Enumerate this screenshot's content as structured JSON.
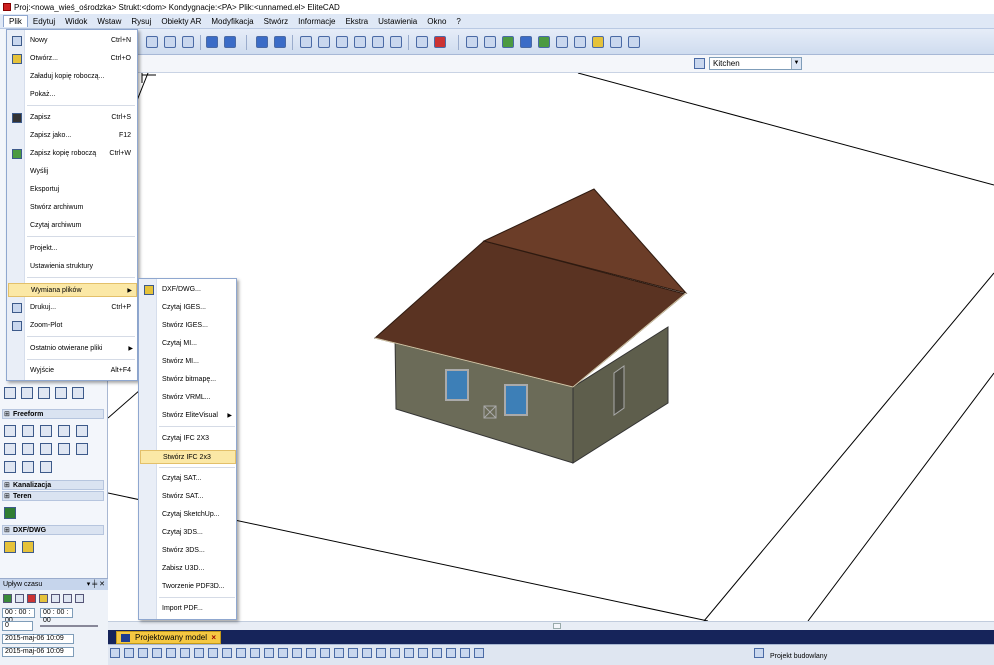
{
  "window": {
    "title": "Proj:<nowa_wieś_ośrodzka> Strukt:<dom>  Kondygnacje:<PA>  Plik:<unnamed.el> EliteCAD"
  },
  "menubar": [
    "Plik",
    "Edytuj",
    "Widok",
    "Wstaw",
    "Rysuj",
    "Obiekty AR",
    "Modyfikacja",
    "Stwórz",
    "Informacje",
    "Ekstra",
    "Ustawienia",
    "Okno",
    "?"
  ],
  "layer_combo": {
    "value": "Kitchen"
  },
  "file_menu": [
    {
      "label": "Nowy",
      "shortcut": "Ctrl+N",
      "icon": "new-file-icon"
    },
    {
      "label": "Otwórz...",
      "shortcut": "Ctrl+O",
      "icon": "open-folder-icon"
    },
    {
      "label": "Załaduj kopię roboczą...",
      "shortcut": "",
      "icon": ""
    },
    {
      "label": "Pokaż...",
      "shortcut": "",
      "icon": ""
    },
    {
      "label": "Zapisz",
      "shortcut": "Ctrl+S",
      "icon": "save-icon"
    },
    {
      "label": "Zapisz jako...",
      "shortcut": "F12",
      "icon": ""
    },
    {
      "label": "Zapisz kopię roboczą",
      "shortcut": "Ctrl+W",
      "icon": "save-copy-icon"
    },
    {
      "label": "Wyślij",
      "shortcut": "",
      "icon": ""
    },
    {
      "label": "Eksportuj",
      "shortcut": "",
      "icon": ""
    },
    {
      "label": "Stwórz archiwum",
      "shortcut": "",
      "icon": ""
    },
    {
      "label": "Czytaj archiwum",
      "shortcut": "",
      "icon": ""
    },
    {
      "label": "Projekt...",
      "shortcut": "",
      "icon": ""
    },
    {
      "label": "Ustawienia struktury",
      "shortcut": "",
      "icon": ""
    },
    {
      "label": "Wymiana plików",
      "shortcut": "",
      "icon": ""
    },
    {
      "label": "Drukuj...",
      "shortcut": "Ctrl+P",
      "icon": "print-icon"
    },
    {
      "label": "Zoom-Plot",
      "shortcut": "",
      "icon": "zoom-plot-icon"
    },
    {
      "label": "Ostatnio otwierane pliki",
      "shortcut": "",
      "icon": ""
    },
    {
      "label": "Wyjście",
      "shortcut": "Alt+F4",
      "icon": ""
    }
  ],
  "exchange_submenu": [
    "DXF/DWG...",
    "Czytaj IGES...",
    "Stwórz IGES...",
    "Czytaj MI...",
    "Stwórz MI...",
    "Stwórz bitmapę...",
    "Stwórz VRML...",
    "Stwórz EliteVisual",
    "Czytaj IFC 2X3",
    "Stwórz IFC 2x3",
    "Czytaj SAT...",
    "Stwórz SAT...",
    "Czytaj SketchUp...",
    "Czytaj 3DS...",
    "Stwórz 3DS...",
    "Zabisz U3D...",
    "Tworzenie PDF3D...",
    "Import PDF..."
  ],
  "left_panel": {
    "sections": [
      "Freeform",
      "Kanalizacja",
      "Teren",
      "DXF/DWG"
    ]
  },
  "time_panel": {
    "title": "Upływ czasu",
    "time_from": "00 : 00 : 00",
    "time_to": "00 : 00 : 00",
    "value": "0",
    "date1": "2015-maj-06 10:09",
    "date2": "2015-maj-06 10:09"
  },
  "tabs": {
    "model_tab": "Projektowany model"
  },
  "status": {
    "project_type": "Projekt budowlany"
  },
  "colors": {
    "accent": "#f5c842",
    "roof": "#5a3322",
    "wall": "#6b6b58",
    "menu_highlight": "#fbe8a6"
  }
}
